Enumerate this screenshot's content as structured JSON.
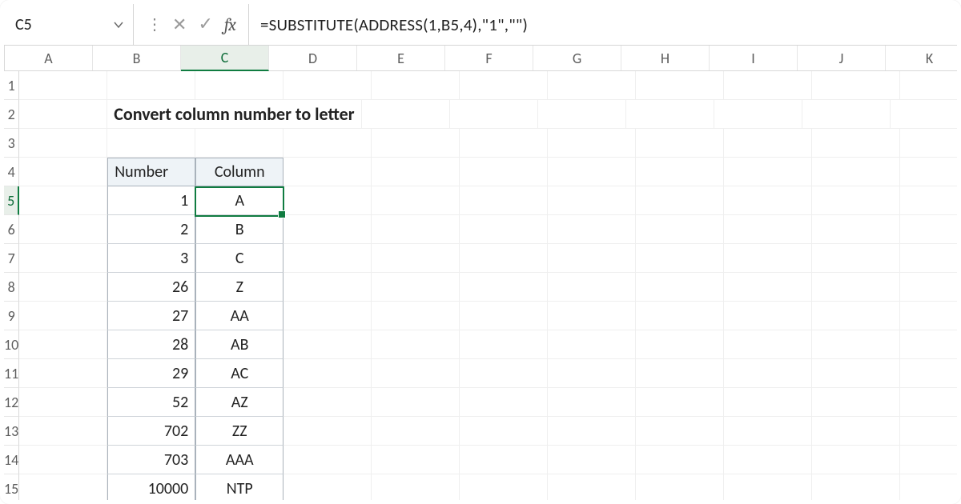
{
  "name_box": {
    "value": "C5"
  },
  "fx_label": "fx",
  "formula": "=SUBSTITUTE(ADDRESS(1,B5,4),\"1\",\"\")",
  "columns": [
    "A",
    "B",
    "C",
    "D",
    "E",
    "F",
    "G",
    "H",
    "I",
    "J",
    "K"
  ],
  "active_col_index": 2,
  "row_numbers": [
    1,
    2,
    3,
    4,
    5,
    6,
    7,
    8,
    9,
    10,
    11,
    12,
    13,
    14,
    15
  ],
  "active_row_index": 4,
  "title": "Convert column number to letter",
  "table": {
    "headers": {
      "number": "Number",
      "column": "Column"
    },
    "rows": [
      {
        "number": "1",
        "column": "A"
      },
      {
        "number": "2",
        "column": "B"
      },
      {
        "number": "3",
        "column": "C"
      },
      {
        "number": "26",
        "column": "Z"
      },
      {
        "number": "27",
        "column": "AA"
      },
      {
        "number": "28",
        "column": "AB"
      },
      {
        "number": "29",
        "column": "AC"
      },
      {
        "number": "52",
        "column": "AZ"
      },
      {
        "number": "702",
        "column": "ZZ"
      },
      {
        "number": "703",
        "column": "AAA"
      },
      {
        "number": "10000",
        "column": "NTP"
      }
    ]
  }
}
